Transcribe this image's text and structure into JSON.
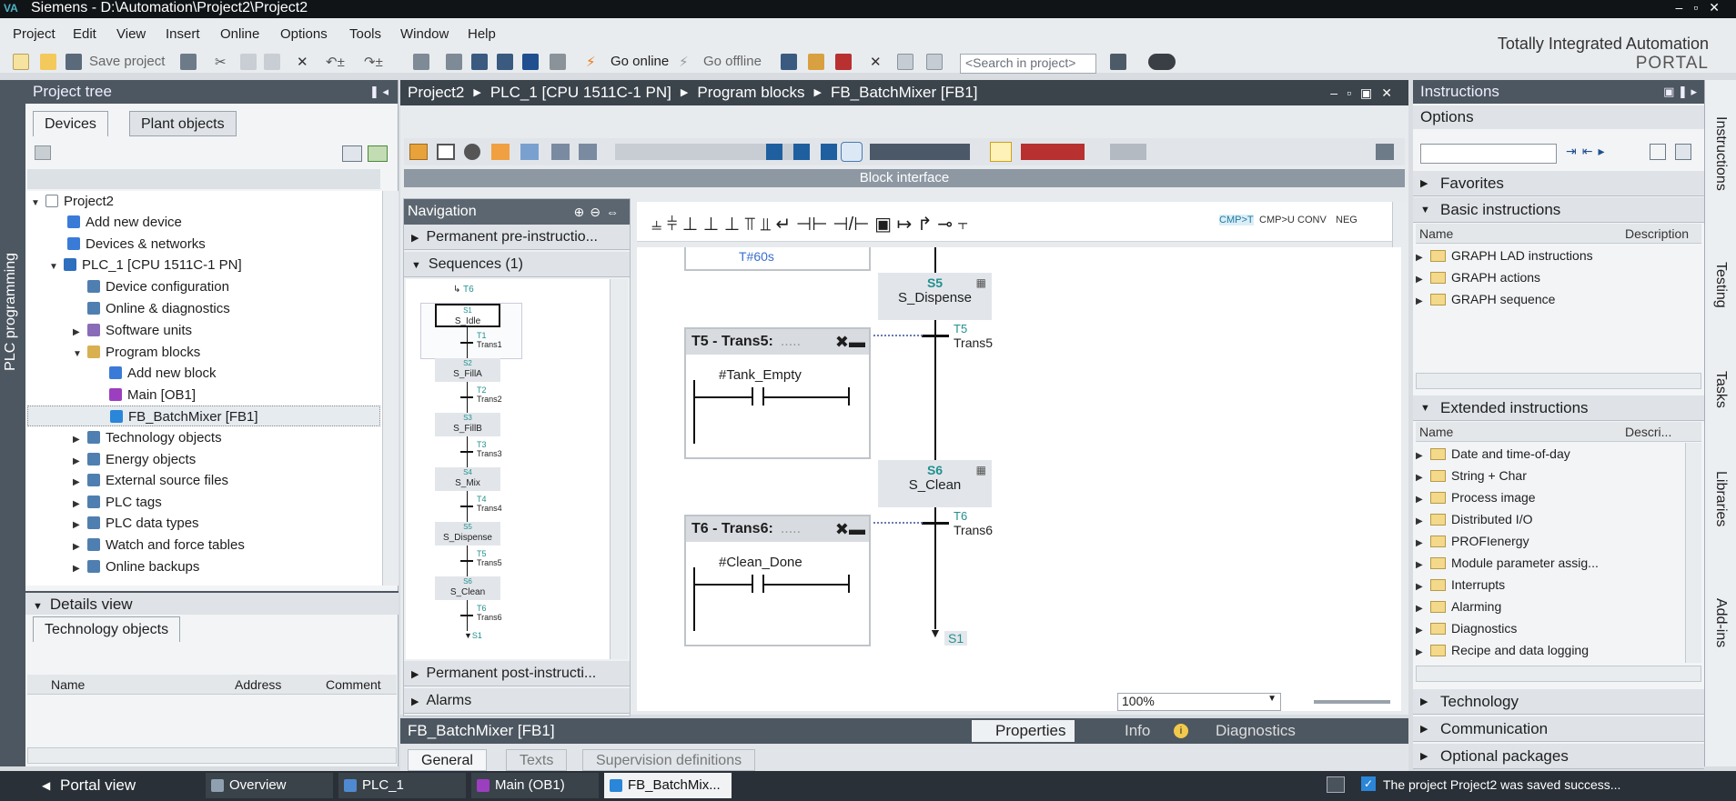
{
  "window": {
    "title": "Siemens  -  D:\\Automation\\Project2\\Project2",
    "logo": "VA"
  },
  "menu": [
    "Project",
    "Edit",
    "View",
    "Insert",
    "Online",
    "Options",
    "Tools",
    "Window",
    "Help"
  ],
  "toolbar": {
    "save": "Save project",
    "go_online": "Go online",
    "go_offline": "Go offline",
    "search_placeholder": "<Search in project>"
  },
  "brand": {
    "line1": "Totally Integrated Automation",
    "line2": "PORTAL"
  },
  "left_sidebar": {
    "label": "PLC programming"
  },
  "project_tree": {
    "title": "Project tree",
    "tabs": [
      "Devices",
      "Plant objects"
    ],
    "items": [
      {
        "label": "Project2",
        "indent": 0,
        "color": "#ffffff"
      },
      {
        "label": "Add new device",
        "indent": 1,
        "color": "#3b7bd8"
      },
      {
        "label": "Devices & networks",
        "indent": 1,
        "color": "#3b7bd8"
      },
      {
        "label": "PLC_1 [CPU 1511C-1 PN]",
        "indent": 1,
        "color": "#2e6fbf"
      },
      {
        "label": "Device configuration",
        "indent": 2,
        "color": "#4f7fb0"
      },
      {
        "label": "Online & diagnostics",
        "indent": 2,
        "color": "#4f7fb0"
      },
      {
        "label": "Software units",
        "indent": 2,
        "color": "#8a6bb8"
      },
      {
        "label": "Program blocks",
        "indent": 2,
        "color": "#d8b050"
      },
      {
        "label": "Add new block",
        "indent": 3,
        "color": "#3b7bd8"
      },
      {
        "label": "Main [OB1]",
        "indent": 3,
        "color": "#9b3fbf"
      },
      {
        "label": "FB_BatchMixer [FB1]",
        "indent": 3,
        "color": "#2a86d8"
      },
      {
        "label": "Technology objects",
        "indent": 2,
        "color": "#4f7fb0"
      },
      {
        "label": "Energy objects",
        "indent": 2,
        "color": "#4f7fb0"
      },
      {
        "label": "External source files",
        "indent": 2,
        "color": "#4f7fb0"
      },
      {
        "label": "PLC tags",
        "indent": 2,
        "color": "#4f7fb0"
      },
      {
        "label": "PLC data types",
        "indent": 2,
        "color": "#4f7fb0"
      },
      {
        "label": "Watch and force tables",
        "indent": 2,
        "color": "#4f7fb0"
      },
      {
        "label": "Online backups",
        "indent": 2,
        "color": "#4f7fb0"
      }
    ]
  },
  "details_view": {
    "title": "Details view",
    "tab": "Technology objects",
    "cols": [
      "Name",
      "Address",
      "Comment"
    ]
  },
  "editor": {
    "breadcrumb": [
      "Project2",
      "PLC_1 [CPU 1511C-1 PN]",
      "Program blocks",
      "FB_BatchMixer [FB1]"
    ],
    "block_interface": "Block interface",
    "zoom": "100%"
  },
  "navigation": {
    "title": "Navigation",
    "sections": [
      "Permanent pre-instructio...",
      "Sequences (1)",
      "Permanent post-instructi...",
      "Alarms"
    ],
    "seq_items": [
      {
        "step": "S1",
        "name": "S_Idle",
        "tnum": "T1",
        "tname": "Trans1"
      },
      {
        "step": "S2",
        "name": "S_FillA",
        "tnum": "T2",
        "tname": "Trans2"
      },
      {
        "step": "S3",
        "name": "S_FillB",
        "tnum": "T3",
        "tname": "Trans3"
      },
      {
        "step": "S4",
        "name": "S_Mix",
        "tnum": "T4",
        "tname": "Trans4"
      },
      {
        "step": "S5",
        "name": "S_Dispense",
        "tnum": "T5",
        "tname": "Trans5"
      },
      {
        "step": "S6",
        "name": "S_Clean",
        "tnum": "T6",
        "tname": "Trans6"
      }
    ],
    "top_marker": "T6",
    "end_marker": "S1"
  },
  "ladder_palette": [
    "CMP>T",
    "CMP>U",
    "CONV",
    "NEG"
  ],
  "canvas": {
    "prev_time": "T#60s",
    "steps": [
      {
        "num": "S5",
        "name": "S_Dispense"
      },
      {
        "num": "S6",
        "name": "S_Clean"
      }
    ],
    "transitions": [
      {
        "title": "T5 - Trans5:",
        "dots": ".....",
        "tag": "#Tank_Empty",
        "tnum": "T5",
        "tname": "Trans5"
      },
      {
        "title": "T6 - Trans6:",
        "dots": ".....",
        "tag": "#Clean_Done",
        "tnum": "T6",
        "tname": "Trans6"
      }
    ],
    "jump": "S1"
  },
  "properties": {
    "title": "FB_BatchMixer [FB1]",
    "tabs": [
      "Properties",
      "Info",
      "Diagnostics"
    ],
    "subtabs": [
      "General",
      "Texts",
      "Supervision definitions"
    ]
  },
  "instructions": {
    "title": "Instructions",
    "options": "Options",
    "favorites": "Favorites",
    "basic": {
      "title": "Basic instructions",
      "cols": [
        "Name",
        "Description"
      ],
      "items": [
        "GRAPH LAD instructions",
        "GRAPH actions",
        "GRAPH sequence"
      ]
    },
    "extended": {
      "title": "Extended instructions",
      "cols": [
        "Name",
        "Descri..."
      ],
      "items": [
        "Date and time-of-day",
        "String + Char",
        "Process image",
        "Distributed I/O",
        "PROFIenergy",
        "Module parameter assig...",
        "Interrupts",
        "Alarming",
        "Diagnostics",
        "Recipe and data logging"
      ]
    },
    "technology": "Technology",
    "communication": "Communication",
    "optional": "Optional packages"
  },
  "right_tabs": [
    "Instructions",
    "Testing",
    "Tasks",
    "Libraries",
    "Add-ins"
  ],
  "statusbar": {
    "portal": "Portal view",
    "tabs": [
      "Overview",
      "PLC_1",
      "Main (OB1)",
      "FB_BatchMix..."
    ],
    "message": "The project Project2 was saved success..."
  }
}
